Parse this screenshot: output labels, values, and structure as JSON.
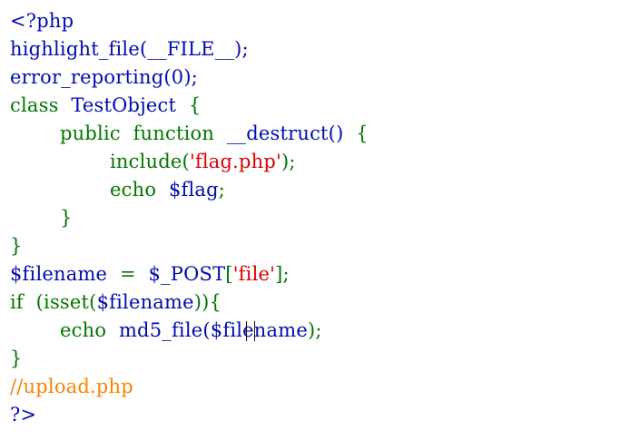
{
  "colors": {
    "default": "#000BB0",
    "keyword": "#007700",
    "string": "#DD0000",
    "comment": "#FF8000",
    "html": "#000000"
  },
  "code_lines": [
    {
      "tokens": [
        {
          "text": "<?php",
          "kind": "default"
        }
      ]
    },
    {
      "tokens": [
        {
          "text": "highlight_file(__FILE__);",
          "kind": "default"
        }
      ]
    },
    {
      "tokens": [
        {
          "text": "error_reporting(0);",
          "kind": "default"
        }
      ]
    },
    {
      "tokens": [
        {
          "text": "class",
          "kind": "keyword"
        },
        {
          "text": "  TestObject  ",
          "kind": "default"
        },
        {
          "text": "{",
          "kind": "keyword"
        }
      ]
    },
    {
      "tokens": [
        {
          "text": "        ",
          "kind": "default"
        },
        {
          "text": "public  function  ",
          "kind": "keyword"
        },
        {
          "text": "__destruct()",
          "kind": "default"
        },
        {
          "text": "  {",
          "kind": "keyword"
        }
      ]
    },
    {
      "tokens": [
        {
          "text": "                ",
          "kind": "default"
        },
        {
          "text": "include(",
          "kind": "keyword"
        },
        {
          "text": "'flag.php'",
          "kind": "string"
        },
        {
          "text": ");",
          "kind": "keyword"
        }
      ]
    },
    {
      "tokens": [
        {
          "text": "                ",
          "kind": "default"
        },
        {
          "text": "echo  ",
          "kind": "keyword"
        },
        {
          "text": "$flag",
          "kind": "default"
        },
        {
          "text": ";",
          "kind": "keyword"
        }
      ]
    },
    {
      "tokens": [
        {
          "text": "        ",
          "kind": "default"
        },
        {
          "text": "}",
          "kind": "keyword"
        }
      ]
    },
    {
      "tokens": [
        {
          "text": "}",
          "kind": "keyword"
        }
      ]
    },
    {
      "tokens": [
        {
          "text": "$filename",
          "kind": "default"
        },
        {
          "text": "  =  ",
          "kind": "keyword"
        },
        {
          "text": "$_POST",
          "kind": "default"
        },
        {
          "text": "[",
          "kind": "keyword"
        },
        {
          "text": "'file'",
          "kind": "string"
        },
        {
          "text": "];",
          "kind": "keyword"
        }
      ]
    },
    {
      "tokens": [
        {
          "text": "if  ",
          "kind": "keyword"
        },
        {
          "text": "(isset(",
          "kind": "keyword"
        },
        {
          "text": "$filename",
          "kind": "default"
        },
        {
          "text": ")){",
          "kind": "keyword"
        }
      ]
    },
    {
      "tokens": [
        {
          "text": "        ",
          "kind": "default"
        },
        {
          "text": "echo  ",
          "kind": "keyword"
        },
        {
          "text": "md5_file(",
          "kind": "default"
        },
        {
          "text": "$filename",
          "kind": "default"
        },
        {
          "text": ");",
          "kind": "keyword"
        }
      ]
    },
    {
      "tokens": [
        {
          "text": "}",
          "kind": "keyword"
        }
      ]
    },
    {
      "tokens": [
        {
          "text": "//upload.php",
          "kind": "comment"
        }
      ]
    },
    {
      "tokens": [
        {
          "text": "?>",
          "kind": "default"
        }
      ]
    }
  ]
}
